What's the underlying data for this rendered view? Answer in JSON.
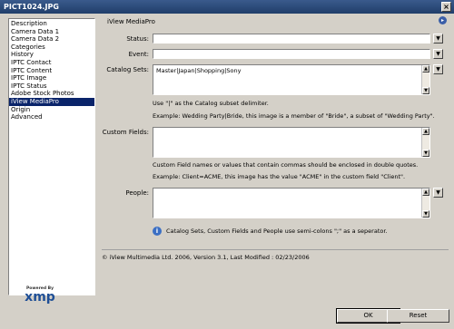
{
  "window": {
    "title": "PICT1024.JPG",
    "close_glyph": "×"
  },
  "sidebar": {
    "items": [
      {
        "label": "Description",
        "selected": false
      },
      {
        "label": "Camera Data 1",
        "selected": false
      },
      {
        "label": "Camera Data 2",
        "selected": false
      },
      {
        "label": "Categories",
        "selected": false
      },
      {
        "label": "History",
        "selected": false
      },
      {
        "label": "IPTC Contact",
        "selected": false
      },
      {
        "label": "IPTC Content",
        "selected": false
      },
      {
        "label": "IPTC Image",
        "selected": false
      },
      {
        "label": "IPTC Status",
        "selected": false
      },
      {
        "label": "Adobe Stock Photos",
        "selected": false
      },
      {
        "label": "iView MediaPro",
        "selected": true
      },
      {
        "label": "Origin",
        "selected": false
      },
      {
        "label": "Advanced",
        "selected": false
      }
    ]
  },
  "panel": {
    "title": "iView MediaPro",
    "status": {
      "label": "Status:",
      "value": ""
    },
    "event": {
      "label": "Event:",
      "value": ""
    },
    "catalog_sets": {
      "label": "Catalog Sets:",
      "value": "Master|Japan|Shopping|Sony",
      "note1": "Use \"|\" as the Catalog subset delimiter.",
      "note2": "Example: Wedding Party|Bride, this image is a member of \"Bride\", a subset of \"Wedding Party\"."
    },
    "custom_fields": {
      "label": "Custom Fields:",
      "value": "",
      "note1": "Custom Field names or values that contain commas should be enclosed in double quotes.",
      "note2": "Example: Client=ACME, this image has the value \"ACME\" in the custom field \"Client\"."
    },
    "people": {
      "label": "People:",
      "value": ""
    },
    "separator_note": "Catalog Sets, Custom Fields and People use semi-colons \";\" as a seperator.",
    "footer": "© iView Multimedia Ltd. 2006,  Version 3.1,  Last Modified : 02/23/2006"
  },
  "xmp": {
    "powered_by": "Powered By",
    "logo_text": "xmp"
  },
  "buttons": {
    "ok": "OK",
    "reset": "Reset"
  },
  "icons": {
    "info": "info-icon",
    "dropdown": "chevron-down-icon",
    "scroll_up": "scroll-up-icon",
    "scroll_down": "scroll-down-icon"
  }
}
